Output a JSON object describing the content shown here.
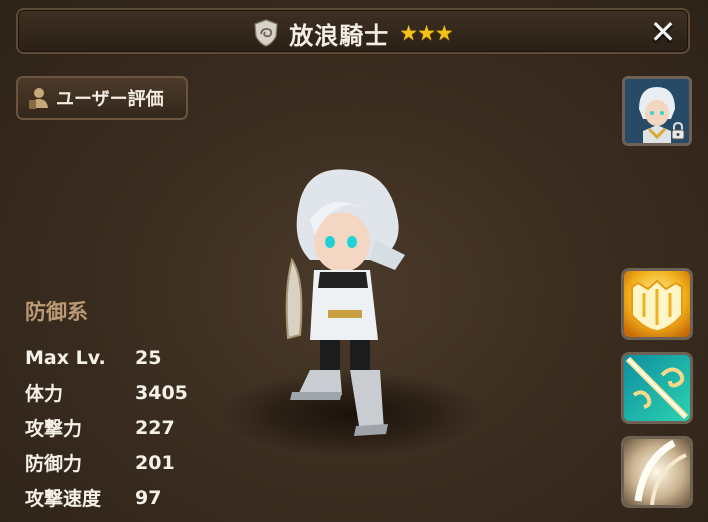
{
  "header": {
    "element_icon": "wind-element-icon",
    "title": "放浪騎士",
    "stars": "★★★",
    "close_label": "✕"
  },
  "review_button": {
    "icon": "user-review-icon",
    "label": "ユーザー評価"
  },
  "portrait": {
    "icon": "hero-portrait",
    "locked": true
  },
  "character": {
    "category": "防御系",
    "stats": [
      {
        "label": "Max Lv.",
        "value": "25"
      },
      {
        "label": "体力",
        "value": "3405"
      },
      {
        "label": "攻撃力",
        "value": "227"
      },
      {
        "label": "防御力",
        "value": "201"
      },
      {
        "label": "攻撃速度",
        "value": "97"
      }
    ]
  },
  "skills": [
    {
      "icon": "shield-skill-icon",
      "color": "#f0b21c"
    },
    {
      "icon": "sword-wind-skill-icon",
      "color": "#21c4b8"
    },
    {
      "icon": "slash-skill-icon",
      "color": "#c8b89a"
    }
  ],
  "colors": {
    "accent_gold": "#f5c21a",
    "category_text": "#b99a74",
    "background": "#3b2d20"
  }
}
